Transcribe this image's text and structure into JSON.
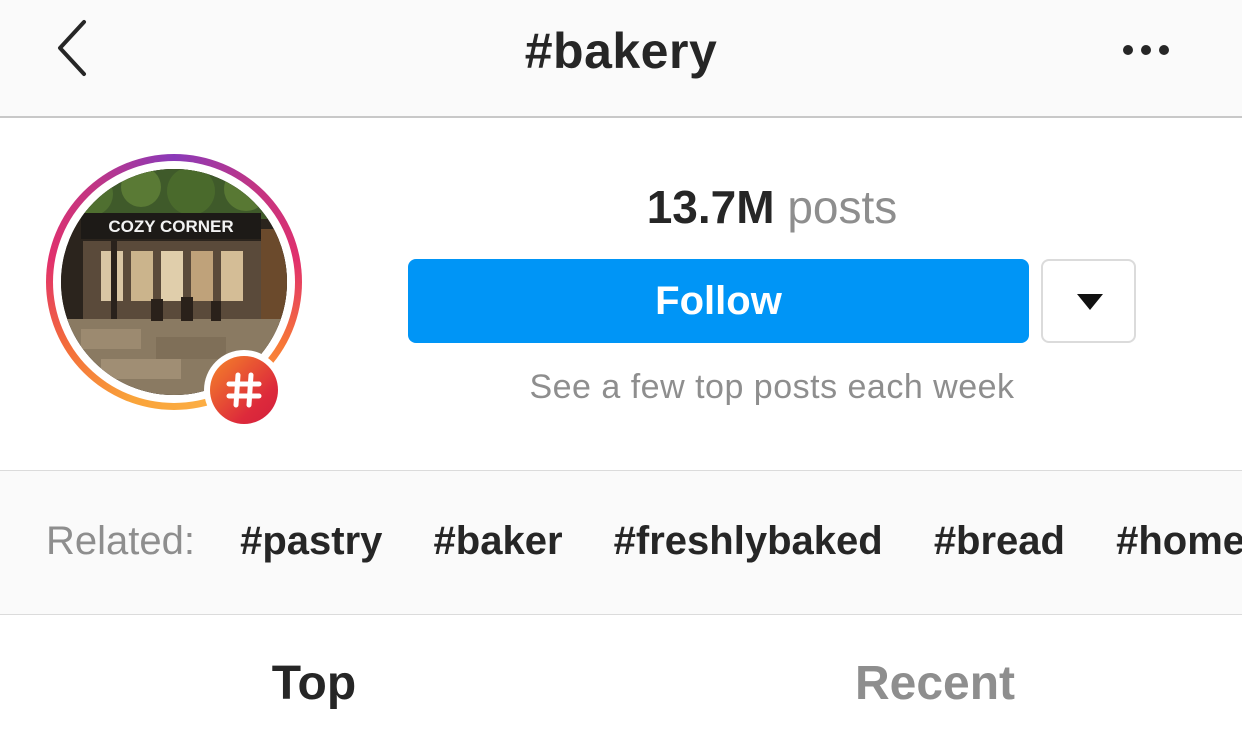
{
  "nav": {
    "back_icon": "chevron-left-icon",
    "title": "#bakery",
    "more_icon": "more-horizontal-icon"
  },
  "header": {
    "avatar_sign_text": "COZY CORNER",
    "badge_icon": "hashtag-icon",
    "post_count": "13.7M",
    "post_count_label": "posts",
    "follow_label": "Follow",
    "dropdown_icon": "caret-down-icon",
    "follow_hint": "See a few top posts each week"
  },
  "related": {
    "label": "Related:",
    "tags": [
      "#pastry",
      "#baker",
      "#freshlybaked",
      "#bread",
      "#homemade"
    ]
  },
  "tabs": [
    {
      "label": "Top",
      "active": true
    },
    {
      "label": "Recent",
      "active": false
    }
  ],
  "colors": {
    "accent": "#0095f6",
    "text_primary": "#262626",
    "text_secondary": "#8e8e8e",
    "nav_background": "#fafafa"
  }
}
